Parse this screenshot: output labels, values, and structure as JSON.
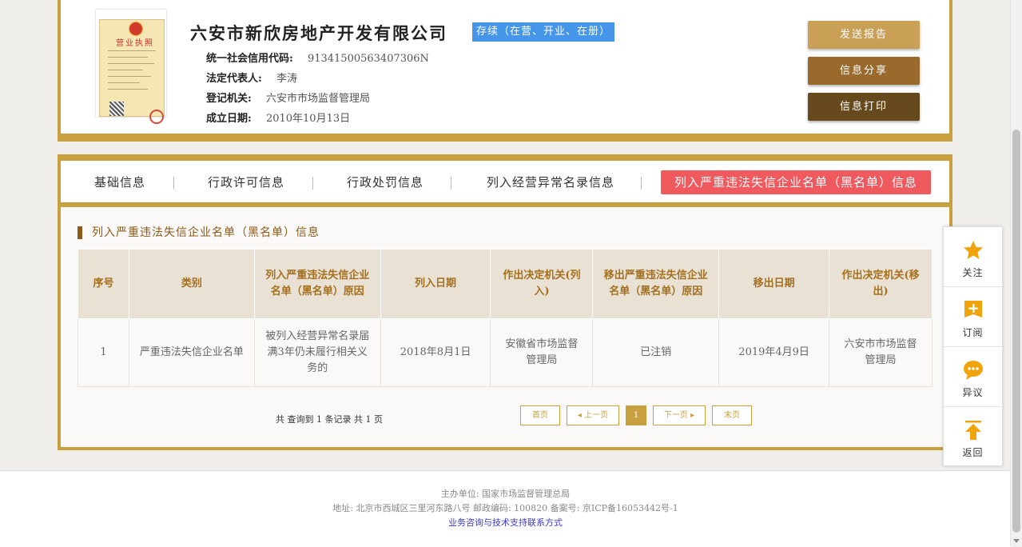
{
  "company": {
    "name": "六安市新欣房地产开发有限公司",
    "status": "存续（在营、开业、在册）",
    "license_title": "营业执照",
    "fields": [
      {
        "label": "统一社会信用代码:",
        "value": "91341500563407306N"
      },
      {
        "label": "法定代表人:",
        "value": "李涛"
      },
      {
        "label": "登记机关:",
        "value": "六安市市场监督管理局"
      },
      {
        "label": "成立日期:",
        "value": "2010年10月13日"
      }
    ]
  },
  "actions": {
    "send_report": "发送报告",
    "share": "信息分享",
    "print": "信息打印"
  },
  "tabs": [
    {
      "label": "基础信息"
    },
    {
      "label": "行政许可信息"
    },
    {
      "label": "行政处罚信息"
    },
    {
      "label": "列入经营异常名录信息"
    },
    {
      "label": "列入严重违法失信企业名单（黑名单）信息"
    }
  ],
  "section": {
    "title": "列入严重违法失信企业名单（黑名单）信息"
  },
  "table": {
    "headers": [
      "序号",
      "类别",
      "列入严重违法失信企业名单（黑名单）原因",
      "列入日期",
      "作出决定机关(列入)",
      "移出严重违法失信企业名单（黑名单）原因",
      "移出日期",
      "作出决定机关(移出)"
    ],
    "rows": [
      [
        "1",
        "严重违法失信企业名单",
        "被列入经营异常名录届满3年仍未履行相关义务的",
        "2018年8月1日",
        "安徽省市场监督管理局",
        "已注销",
        "2019年4月9日",
        "六安市市场监督管理局"
      ]
    ]
  },
  "pagination": {
    "summary": "共 查询到 1 条记录 共 1 页",
    "first": "首页",
    "prev": "◂ 上一页",
    "current": "1",
    "next": "下一页 ▸",
    "last": "末页"
  },
  "float_menu": [
    {
      "label": "关注",
      "icon": "star-icon"
    },
    {
      "label": "订阅",
      "icon": "subscribe-icon"
    },
    {
      "label": "异议",
      "icon": "objection-chat-icon"
    },
    {
      "label": "返回",
      "icon": "back-to-top-icon"
    }
  ],
  "footer": {
    "sponsor": "主办单位: 国家市场监督管理总局",
    "address": "地址: 北京市西城区三里河东路八号  邮政编码: 100820  备案号: 京ICP备16053442号-1",
    "contact_link": "业务咨询与技术支持联系方式"
  },
  "colors": {
    "gold": "#c9a03f",
    "status_blue": "#4596e8",
    "active_tab_red": "#ef5a5f",
    "send_report_btn": "#c9a055",
    "share_btn": "#9a6a2c",
    "print_btn": "#664a1e",
    "menu_icon_orange": "#f0a30a"
  }
}
